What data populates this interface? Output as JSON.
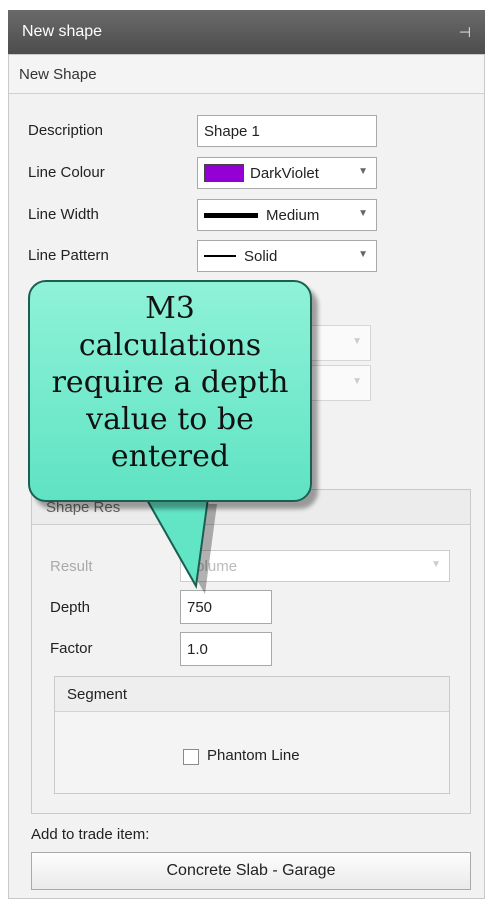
{
  "window": {
    "title": "New shape",
    "pin_icon": "pin-icon"
  },
  "panel": {
    "heading": "New Shape"
  },
  "form": {
    "description_label": "Description",
    "description_value": "Shape 1",
    "line_colour_label": "Line Colour",
    "line_colour_value": "DarkViolet",
    "line_colour_hex": "#9400d3",
    "line_width_label": "Line Width",
    "line_width_value": "Medium",
    "line_pattern_label": "Line Pattern",
    "line_pattern_value": "Solid"
  },
  "shape_result": {
    "group_label": "Shape Res",
    "result_label": "Result",
    "result_value": "Volume",
    "depth_label": "Depth",
    "depth_value": "750",
    "factor_label": "Factor",
    "factor_value": "1.0",
    "segment_label": "Segment",
    "phantom_line_label": "Phantom Line"
  },
  "trade": {
    "label": "Add to trade item:",
    "button_label": "Concrete Slab - Garage"
  },
  "callout": {
    "line1": "M3",
    "line2": "calculations",
    "line3": "require a depth",
    "line4": "value to be",
    "line5": "entered",
    "color": "#6ee8ca"
  }
}
